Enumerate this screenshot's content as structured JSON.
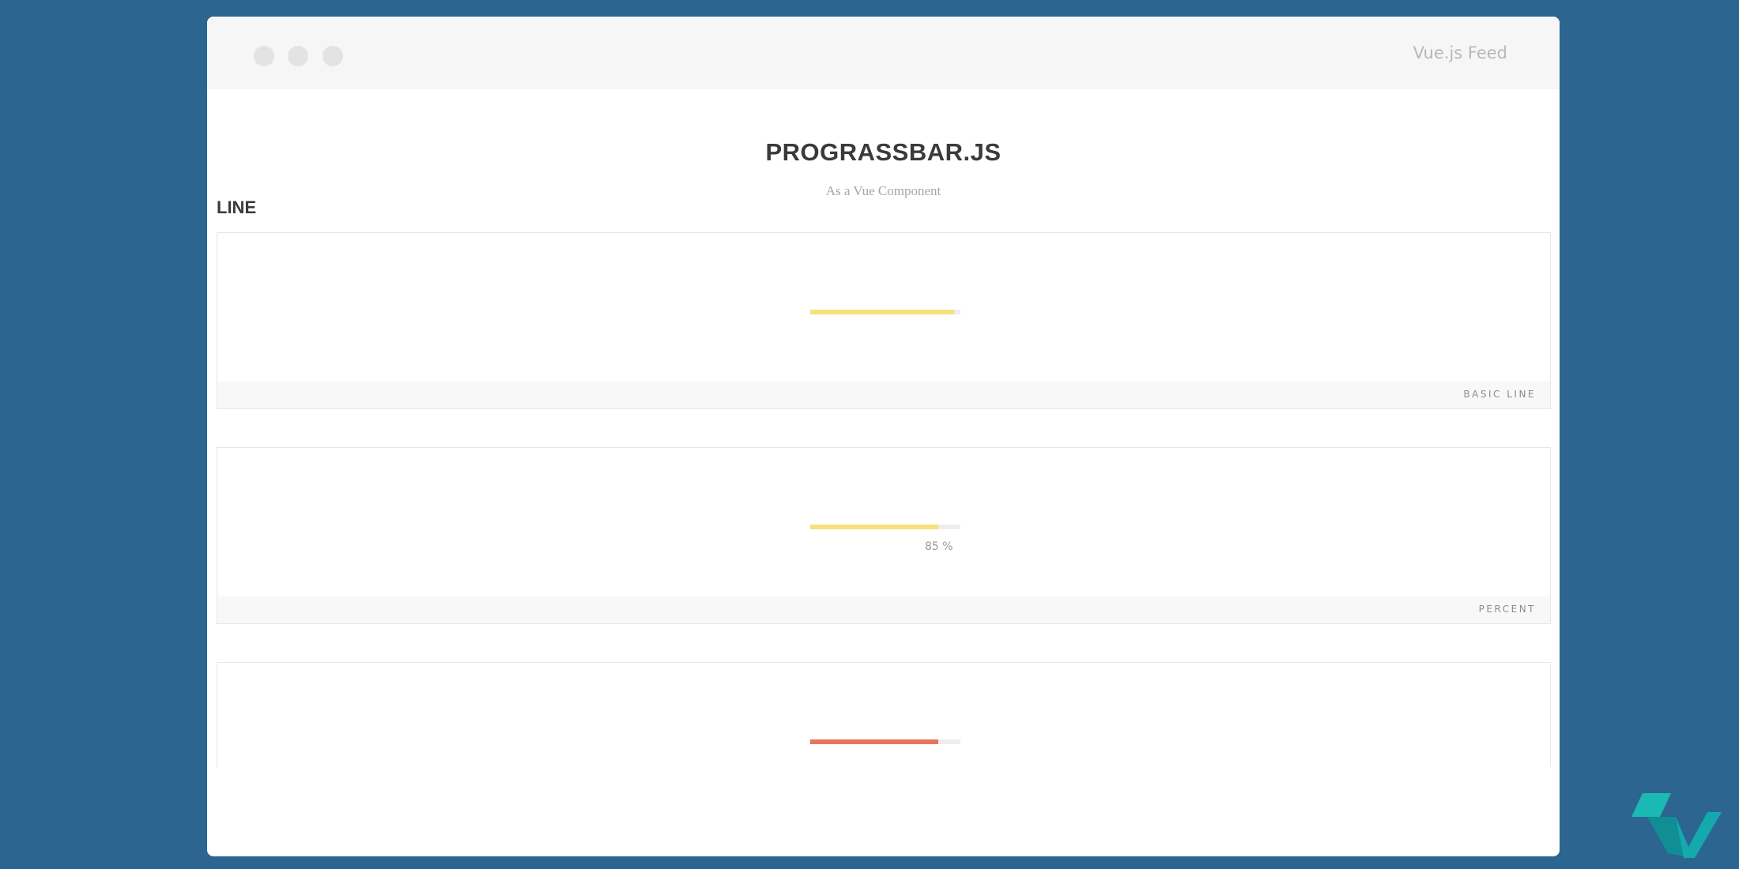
{
  "window": {
    "title": "Vue.js Feed"
  },
  "page": {
    "title": "PROGRASSBAR.JS",
    "subtitle": "As a Vue Component",
    "section_heading": "LINE"
  },
  "cards": [
    {
      "label": "BASIC LINE",
      "progress": 0.96,
      "fill_color": "#f8e07a",
      "percent_text": ""
    },
    {
      "label": "PERCENT",
      "progress": 0.85,
      "fill_color": "#f8e07a",
      "percent_text": "85 %"
    },
    {
      "label": "",
      "progress": 0.85,
      "fill_color": "#e8755f",
      "percent_text": ""
    }
  ],
  "colors": {
    "background": "#2b6590",
    "accent_yellow": "#f8e07a",
    "accent_red": "#e8755f"
  },
  "icons": {
    "window_controls": [
      "window-dot-icon",
      "window-dot-icon",
      "window-dot-icon"
    ],
    "brand_logo": "vue-logo-icon"
  }
}
